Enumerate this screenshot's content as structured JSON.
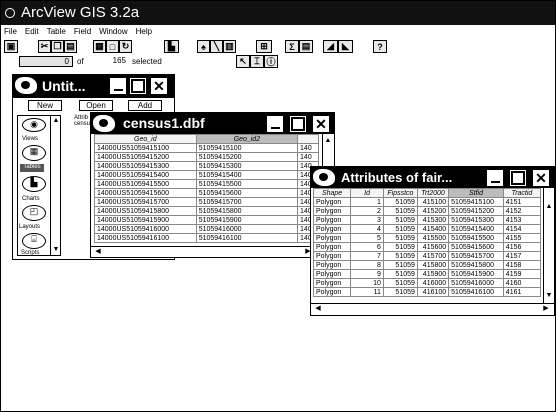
{
  "app": {
    "title": "ArcView GIS 3.2a"
  },
  "menu": [
    "File",
    "Edit",
    "Table",
    "Field",
    "Window",
    "Help"
  ],
  "status": {
    "selected_count": "0",
    "of_label": "of",
    "total": "165",
    "selected_label": "selected"
  },
  "project": {
    "title": "Untit...",
    "buttons": {
      "new": "New",
      "open": "Open",
      "add": "Add"
    },
    "doc_types": [
      "Views",
      "Tables",
      "Charts",
      "Layouts",
      "Scripts"
    ],
    "active_doc_type": "Tables",
    "list_items": [
      "Attrib",
      "censu"
    ]
  },
  "census": {
    "title": "census1.dbf",
    "columns": [
      "Geo_id",
      "Geo_id2",
      ""
    ],
    "rows": [
      [
        "14000US51059415100",
        "51059415100",
        "140"
      ],
      [
        "14000US51059415200",
        "51059415200",
        "140"
      ],
      [
        "14000US51059415300",
        "51059415300",
        "140"
      ],
      [
        "14000US51059415400",
        "51059415400",
        "140"
      ],
      [
        "14000US51059415500",
        "51059415500",
        "140"
      ],
      [
        "14000US51059415600",
        "51059415600",
        "140"
      ],
      [
        "14000US51059415700",
        "51059415700",
        "140"
      ],
      [
        "14000US51059415800",
        "51059415800",
        "140"
      ],
      [
        "14000US51059415900",
        "51059415900",
        "140"
      ],
      [
        "14000US51059416000",
        "51059416000",
        "140"
      ],
      [
        "14000US51059416100",
        "51059416100",
        "140"
      ]
    ]
  },
  "attributes": {
    "title": "Attributes of fair...",
    "columns": [
      "Shape",
      "Id",
      "Fipsstco",
      "Trt2000",
      "Stfid",
      "Tractid"
    ],
    "rows": [
      [
        "Polygon",
        "1",
        "51059",
        "415100",
        "51059415100",
        "4151"
      ],
      [
        "Polygon",
        "2",
        "51059",
        "415200",
        "51059415200",
        "4152"
      ],
      [
        "Polygon",
        "3",
        "51059",
        "415300",
        "51059415300",
        "4153"
      ],
      [
        "Polygon",
        "4",
        "51059",
        "415400",
        "51059415400",
        "4154"
      ],
      [
        "Polygon",
        "5",
        "51059",
        "415500",
        "51059415500",
        "4155"
      ],
      [
        "Polygon",
        "6",
        "51059",
        "415600",
        "51059415600",
        "4156"
      ],
      [
        "Polygon",
        "7",
        "51059",
        "415700",
        "51059415700",
        "4157"
      ],
      [
        "Polygon",
        "8",
        "51059",
        "415800",
        "51059415800",
        "4158"
      ],
      [
        "Polygon",
        "9",
        "51059",
        "415900",
        "51059415900",
        "4159"
      ],
      [
        "Polygon",
        "10",
        "51059",
        "416000",
        "51059416000",
        "4160"
      ],
      [
        "Polygon",
        "11",
        "51059",
        "416100",
        "51059416100",
        "4161"
      ]
    ]
  }
}
